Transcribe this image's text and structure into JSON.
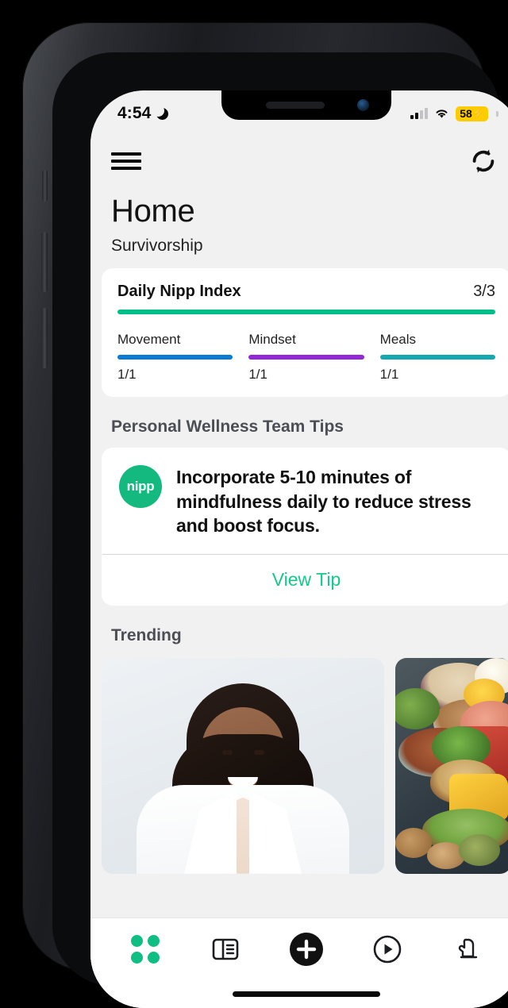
{
  "status_bar": {
    "time": "4:54",
    "dnd_icon": "moon-icon",
    "signal_icon": "cellular-signal-icon",
    "signal_bars_filled": 2,
    "signal_bars_total": 4,
    "wifi_icon": "wifi-icon",
    "battery_percent": "58",
    "battery_charging": true,
    "battery_color": "#FFCC00"
  },
  "app_bar": {
    "menu_icon": "hamburger-menu-icon",
    "refresh_icon": "refresh-sync-icon"
  },
  "header": {
    "title": "Home",
    "subtitle": "Survivorship"
  },
  "index_card": {
    "title": "Daily Nipp Index",
    "score": "3/3",
    "bar_color": "#00be87",
    "metrics": [
      {
        "label": "Movement",
        "value": "1/1",
        "color": "#0b7bd4"
      },
      {
        "label": "Mindset",
        "value": "1/1",
        "color": "#9427d6"
      },
      {
        "label": "Meals",
        "value": "1/1",
        "color": "#14a9b0"
      }
    ]
  },
  "tips": {
    "section_title": "Personal Wellness Team Tips",
    "avatar_label": "nipp",
    "avatar_color": "#14b97f",
    "text": "Incorporate 5-10 minutes of mindfulness daily to reduce stress and boost focus.",
    "action_label": "View Tip",
    "action_color": "#16c98a"
  },
  "trending": {
    "section_title": "Trending",
    "cards": [
      {
        "name": "doctor-portrait-card",
        "alt": "Smiling doctor in white coat"
      },
      {
        "name": "healthy-foods-card",
        "alt": "Bowls of grains, beans, nuts, vegetables and meat"
      }
    ]
  },
  "tab_bar": {
    "items": [
      {
        "name": "tab-dashboard",
        "icon": "grid-dots-icon",
        "active": true
      },
      {
        "name": "tab-articles",
        "icon": "article-layout-icon",
        "active": false
      },
      {
        "name": "tab-add",
        "icon": "plus-circle-icon",
        "active": false
      },
      {
        "name": "tab-media",
        "icon": "play-circle-icon",
        "active": false
      },
      {
        "name": "tab-support",
        "icon": "mitten-hand-icon",
        "active": false
      }
    ],
    "active_color": "#0fbe82"
  },
  "home_indicator": "home-indicator-bar"
}
